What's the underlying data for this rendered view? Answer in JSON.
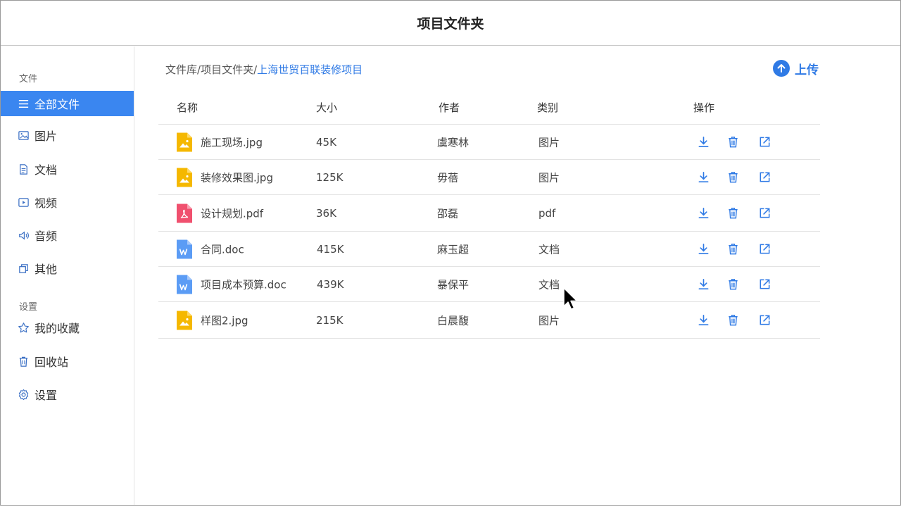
{
  "window": {
    "title": "项目文件夹"
  },
  "sidebar": {
    "group_files": "文件",
    "group_settings": "设置",
    "items": [
      {
        "label": "全部文件",
        "icon": "list-icon"
      },
      {
        "label": "图片",
        "icon": "image-icon"
      },
      {
        "label": "文档",
        "icon": "document-icon"
      },
      {
        "label": "视频",
        "icon": "video-icon"
      },
      {
        "label": "音频",
        "icon": "audio-icon"
      },
      {
        "label": "其他",
        "icon": "copy-icon"
      }
    ],
    "settings_items": [
      {
        "label": "我的收藏",
        "icon": "star-icon"
      },
      {
        "label": "回收站",
        "icon": "trash-icon"
      },
      {
        "label": "设置",
        "icon": "gear-icon"
      }
    ]
  },
  "breadcrumb": {
    "part1": "文件库",
    "sep1": "/",
    "part2": "项目文件夹",
    "sep2": "/",
    "current": "上海世贸百联装修项目"
  },
  "upload": {
    "label": "上传"
  },
  "table": {
    "headers": {
      "name": "名称",
      "size": "大小",
      "author": "作者",
      "category": "类别",
      "actions": "操作"
    },
    "rows": [
      {
        "name": "施工现场.jpg",
        "size": "45K",
        "author": "虞寒林",
        "category": "图片",
        "type": "image"
      },
      {
        "name": "装修效果图.jpg",
        "size": "125K",
        "author": "毋蓓",
        "category": "图片",
        "type": "image"
      },
      {
        "name": "设计规划.pdf",
        "size": "36K",
        "author": "邵磊",
        "category": "pdf",
        "type": "pdf"
      },
      {
        "name": "合同.doc",
        "size": "415K",
        "author": "麻玉超",
        "category": "文档",
        "type": "doc"
      },
      {
        "name": "项目成本预算.doc",
        "size": "439K",
        "author": "暴保平",
        "category": "文档",
        "type": "doc"
      },
      {
        "name": "样图2.jpg",
        "size": "215K",
        "author": "白晨馥",
        "category": "图片",
        "type": "image"
      }
    ]
  },
  "colors": {
    "accent": "#3a86f0",
    "link": "#2f7ae5",
    "image_file": "#f5b800",
    "pdf_file": "#f0506e",
    "doc_file": "#5b9cf5"
  }
}
